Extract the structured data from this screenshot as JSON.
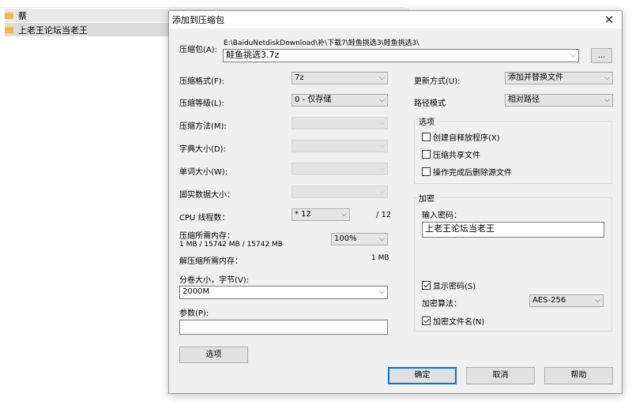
{
  "background": {
    "rows": [
      {
        "name": "蔡"
      },
      {
        "name": "上老王论坛当老王"
      }
    ]
  },
  "dialog": {
    "title": "添加到压缩包",
    "archive_label": "压缩包(A):",
    "archive_path": "E:\\BaiduNetdiskDownload\\补\\下载7\\鲑鱼挑选3\\鲑鱼挑选3\\",
    "archive_name": "鲑鱼挑选3.7z",
    "browse_label": "...",
    "format_label": "压缩格式(F):",
    "format_value": "7z",
    "level_label": "压缩等级(L):",
    "level_value": "0 - 仅存储",
    "method_label": "压缩方法(M):",
    "dict_label": "字典大小(D):",
    "word_label": "单词大小(W):",
    "solid_label": "固实数据大小：",
    "cpu_label": "CPU 线程数：",
    "cpu_value": "* 12",
    "cpu_total": "/ 12",
    "mem_compress_label": "压缩所需内存：",
    "mem_compress_value": "1 MB / 15742 MB / 15742 MB",
    "mem_percent": "100%",
    "mem_decompress_label": "解压缩所需内存：",
    "mem_decompress_value": "1 MB",
    "volume_label": "分卷大小，字节(V):",
    "volume_value": "2000M",
    "params_label": "参数(P):",
    "params_value": "",
    "options_button": "选项",
    "update_label": "更新方式(U):",
    "update_value": "添加并替换文件",
    "pathmode_label": "路径模式",
    "pathmode_value": "相对路径",
    "options_group": "选项",
    "opt_sfx": "创建自释放程序(X)",
    "opt_shared": "压缩共享文件",
    "opt_delete": "操作完成后删除源文件",
    "encrypt_group": "加密",
    "password_label": "输入密码：",
    "password_value": "上老王论坛当老王",
    "show_password": "显示密码(S)",
    "enc_method_label": "加密算法：",
    "enc_method_value": "AES-256",
    "encrypt_names": "加密文件名(N)",
    "ok": "确定",
    "cancel": "取消",
    "help": "帮助",
    "checks": {
      "sfx": false,
      "shared": false,
      "delete": false,
      "show_password": true,
      "encrypt_names": true
    }
  }
}
